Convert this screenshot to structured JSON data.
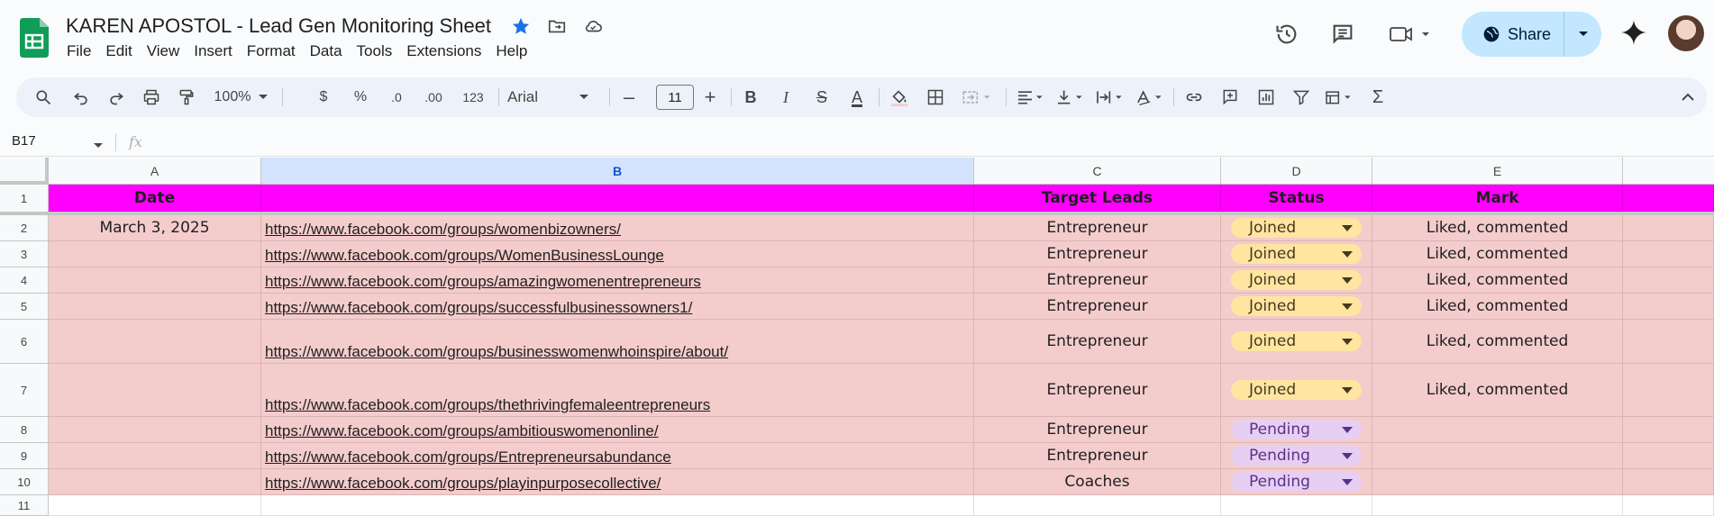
{
  "app": {
    "title": "KAREN APOSTOL - Lead Gen Monitoring Sheet",
    "menu": [
      "File",
      "Edit",
      "View",
      "Insert",
      "Format",
      "Data",
      "Tools",
      "Extensions",
      "Help"
    ],
    "share_label": "Share"
  },
  "toolbar": {
    "zoom": "100%",
    "currency": "$",
    "percent": "%",
    "decrease_decimal": ".0",
    "increase_decimal": ".00",
    "number_format": "123",
    "font": "Arial",
    "font_size": "11",
    "bold": "B",
    "italic": "I",
    "strike": "S",
    "text_color": "A"
  },
  "formula_bar": {
    "cell_ref": "B17",
    "fx": "fx"
  },
  "sheet": {
    "columns": [
      "A",
      "B",
      "C",
      "D",
      "E"
    ],
    "selected_column": "B",
    "headers": {
      "a": "Date",
      "b": "",
      "c": "Target Leads",
      "d": "Status",
      "e": "Mark"
    },
    "row_numbers": [
      "1",
      "2",
      "3",
      "4",
      "5",
      "6",
      "7",
      "8",
      "9",
      "10",
      "11"
    ],
    "rows": [
      {
        "date": "March 3, 2025",
        "url": "https://www.facebook.com/groups/womenbizowners/",
        "target": "Entrepreneur",
        "status": "Joined",
        "mark": "Liked, commented"
      },
      {
        "date": "",
        "url": "https://www.facebook.com/groups/WomenBusinessLounge",
        "target": "Entrepreneur",
        "status": "Joined",
        "mark": "Liked, commented"
      },
      {
        "date": "",
        "url": "https://www.facebook.com/groups/amazingwomenentrepreneurs",
        "target": "Entrepreneur",
        "status": "Joined",
        "mark": "Liked, commented"
      },
      {
        "date": "",
        "url": "https://www.facebook.com/groups/successfulbusinessowners1/",
        "target": "Entrepreneur",
        "status": "Joined",
        "mark": "Liked, commented"
      },
      {
        "date": "",
        "url": "https://www.facebook.com/groups/businesswomenwhoinspire/about/",
        "target": "Entrepreneur",
        "status": "Joined",
        "mark": "Liked, commented"
      },
      {
        "date": "",
        "url": "https://www.facebook.com/groups/thethrivingfemaleentrepreneurs",
        "target": "Entrepreneur",
        "status": "Joined",
        "mark": "Liked, commented"
      },
      {
        "date": "",
        "url": "https://www.facebook.com/groups/ambitiouswomenonline/",
        "target": "Entrepreneur",
        "status": "Pending",
        "mark": ""
      },
      {
        "date": "",
        "url": "https://www.facebook.com/groups/Entrepreneursabundance",
        "target": "Entrepreneur",
        "status": "Pending",
        "mark": ""
      },
      {
        "date": "",
        "url": "https://www.facebook.com/groups/playinpurposecollective/",
        "target": "Coaches",
        "status": "Pending",
        "mark": ""
      }
    ]
  },
  "colors": {
    "header_fill": "#ff00ff",
    "row_fill": "#f4cccc",
    "joined_chip": "#ffe5a0",
    "pending_chip": "#e6cff2",
    "share_button": "#c2e7ff",
    "sheets_green": "#0f9d58"
  }
}
